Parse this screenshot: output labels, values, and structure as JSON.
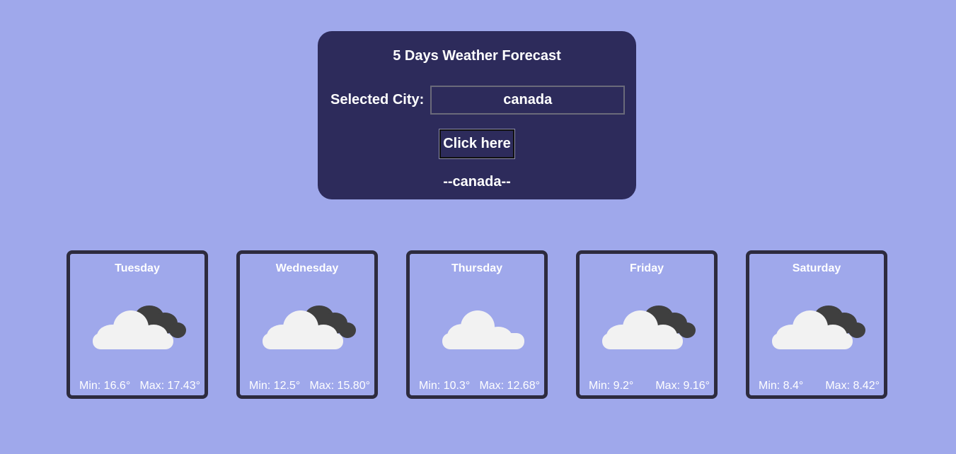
{
  "header": {
    "title": "5 Days Weather Forecast",
    "city_label": "Selected City:",
    "city_value": "canada",
    "button_label": "Click here",
    "city_display": "--canada--"
  },
  "forecast": [
    {
      "day": "Tuesday",
      "icon": "partly-cloudy-night-icon",
      "min": "Min: 16.6°",
      "max": "Max: 17.43°"
    },
    {
      "day": "Wednesday",
      "icon": "partly-cloudy-night-icon",
      "min": "Min: 12.5°",
      "max": "Max: 15.80°"
    },
    {
      "day": "Thursday",
      "icon": "cloud-icon",
      "min": "Min: 10.3°",
      "max": "Max: 12.68°"
    },
    {
      "day": "Friday",
      "icon": "partly-cloudy-night-icon",
      "min": "Min: 9.2°",
      "max": "Max: 9.16°"
    },
    {
      "day": "Saturday",
      "icon": "partly-cloudy-night-icon",
      "min": "Min: 8.4°",
      "max": "Max: 8.42°"
    }
  ],
  "colors": {
    "background": "#9fa8eb",
    "panel": "#2d2b5b",
    "card_border": "#2d2b3e"
  }
}
